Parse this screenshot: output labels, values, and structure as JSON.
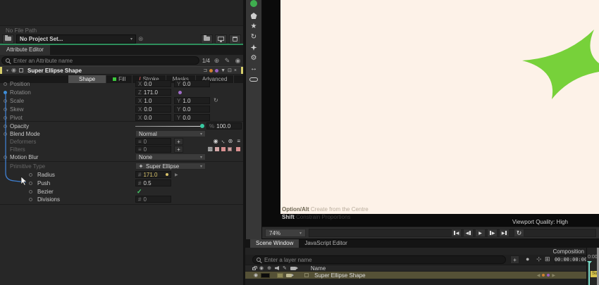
{
  "colors": {
    "accent_green": "#77d13a",
    "canvas_cream": "#fdf2e8",
    "keyframe_yellow": "#d9c36a",
    "keyframe_purple": "#a06cc8",
    "connector_blue": "#3f7fd0",
    "playhead_teal": "#7adbc8",
    "clip_yellow": "#d9c44d",
    "selection_olive": "#555136"
  },
  "project_bar": {
    "file_path": "No File Path",
    "project_select": "No Project Set..."
  },
  "attribute_editor": {
    "panel_tab": "Attribute Editor",
    "search_placeholder": "Enter an Attribute name",
    "match_count": "1/4",
    "header_title": "Super Ellipse Shape",
    "tabs": {
      "shape": "Shape",
      "fill": "Fill",
      "stroke": "Stroke",
      "masks": "Masks",
      "advanced": "Advanced"
    },
    "prefixes": {
      "x": "X",
      "y": "Y",
      "z": "Z",
      "percent": "%",
      "hash": "#"
    },
    "transform": {
      "position": {
        "label": "Position",
        "x": "0.0",
        "y": "0.0"
      },
      "rotation": {
        "label": "Rotation",
        "z": "171.0"
      },
      "scale": {
        "label": "Scale",
        "x": "1.0",
        "y": "1.0"
      },
      "skew": {
        "label": "Skew",
        "x": "0.0",
        "y": "0.0"
      },
      "pivot": {
        "label": "Pivot",
        "x": "0.0",
        "y": "0.0"
      }
    },
    "opacity": {
      "label": "Opacity",
      "value": "100.0"
    },
    "blend_mode": {
      "label": "Blend Mode",
      "value": "Normal"
    },
    "deformers": {
      "label": "Deformers",
      "count": "0"
    },
    "filters": {
      "label": "Filters",
      "count": "0"
    },
    "motion_blur": {
      "label": "Motion Blur",
      "value": "None"
    },
    "primitive": {
      "type_label": "Primitive Type",
      "type_value": "Super Ellipse",
      "radius": {
        "label": "Radius",
        "value": "171.0"
      },
      "push": {
        "label": "Push",
        "value": "0.5"
      },
      "bezier": {
        "label": "Bezier",
        "checked": "✓"
      },
      "divisions": {
        "label": "Divisions",
        "value": "0"
      }
    }
  },
  "viewport": {
    "hint1_key": "Option/Alt",
    "hint1_text": "Create from the Centre",
    "hint2_key": "Shift",
    "hint2_text": "Constrain Proportions",
    "quality": "Viewport Quality: High",
    "zoom_level": "74%"
  },
  "timeline": {
    "tab_scene": "Scene Window",
    "tab_js": "JavaScript Editor",
    "composition_label": "Composition",
    "search_placeholder": "Enter a layer name",
    "timecode": "00:00:00:00",
    "name_header": "Name",
    "layer_name": "Super Ellipse Shape",
    "ruler_start": "0:00",
    "clip_label": "Sup"
  }
}
